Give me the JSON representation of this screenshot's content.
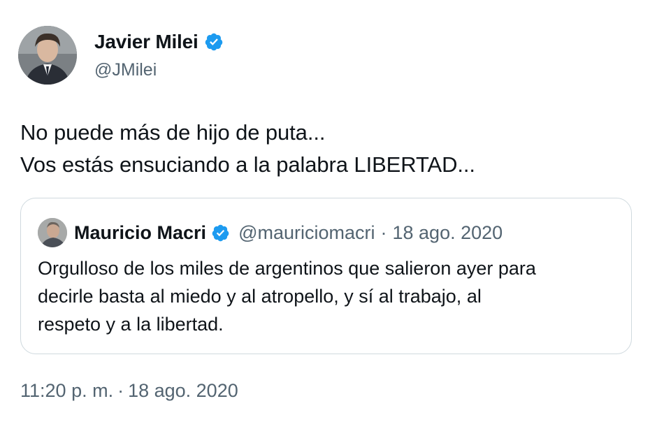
{
  "author": {
    "name": "Javier Milei",
    "handle": "@JMilei",
    "verified": true
  },
  "tweet": {
    "lines": [
      "No puede más de hijo de puta...",
      "Vos estás ensuciando a la palabra LIBERTAD..."
    ]
  },
  "quote": {
    "name": "Mauricio Macri",
    "verified": true,
    "handle": "@mauriciomacri",
    "separator": "·",
    "date": "18 ago. 2020",
    "lines": [
      "Orgulloso de los miles de argentinos que salieron ayer para",
      "decirle basta al miedo y al atropello, y sí al trabajo, al",
      "respeto y a la libertad."
    ]
  },
  "footer": {
    "time": "11:20 p. m.",
    "separator": "·",
    "date": "18 ago. 2020"
  },
  "colors": {
    "verified_blue": "#1d9bf0",
    "secondary_text": "#536471",
    "primary_text": "#0f1419",
    "border": "#cfd9de"
  }
}
